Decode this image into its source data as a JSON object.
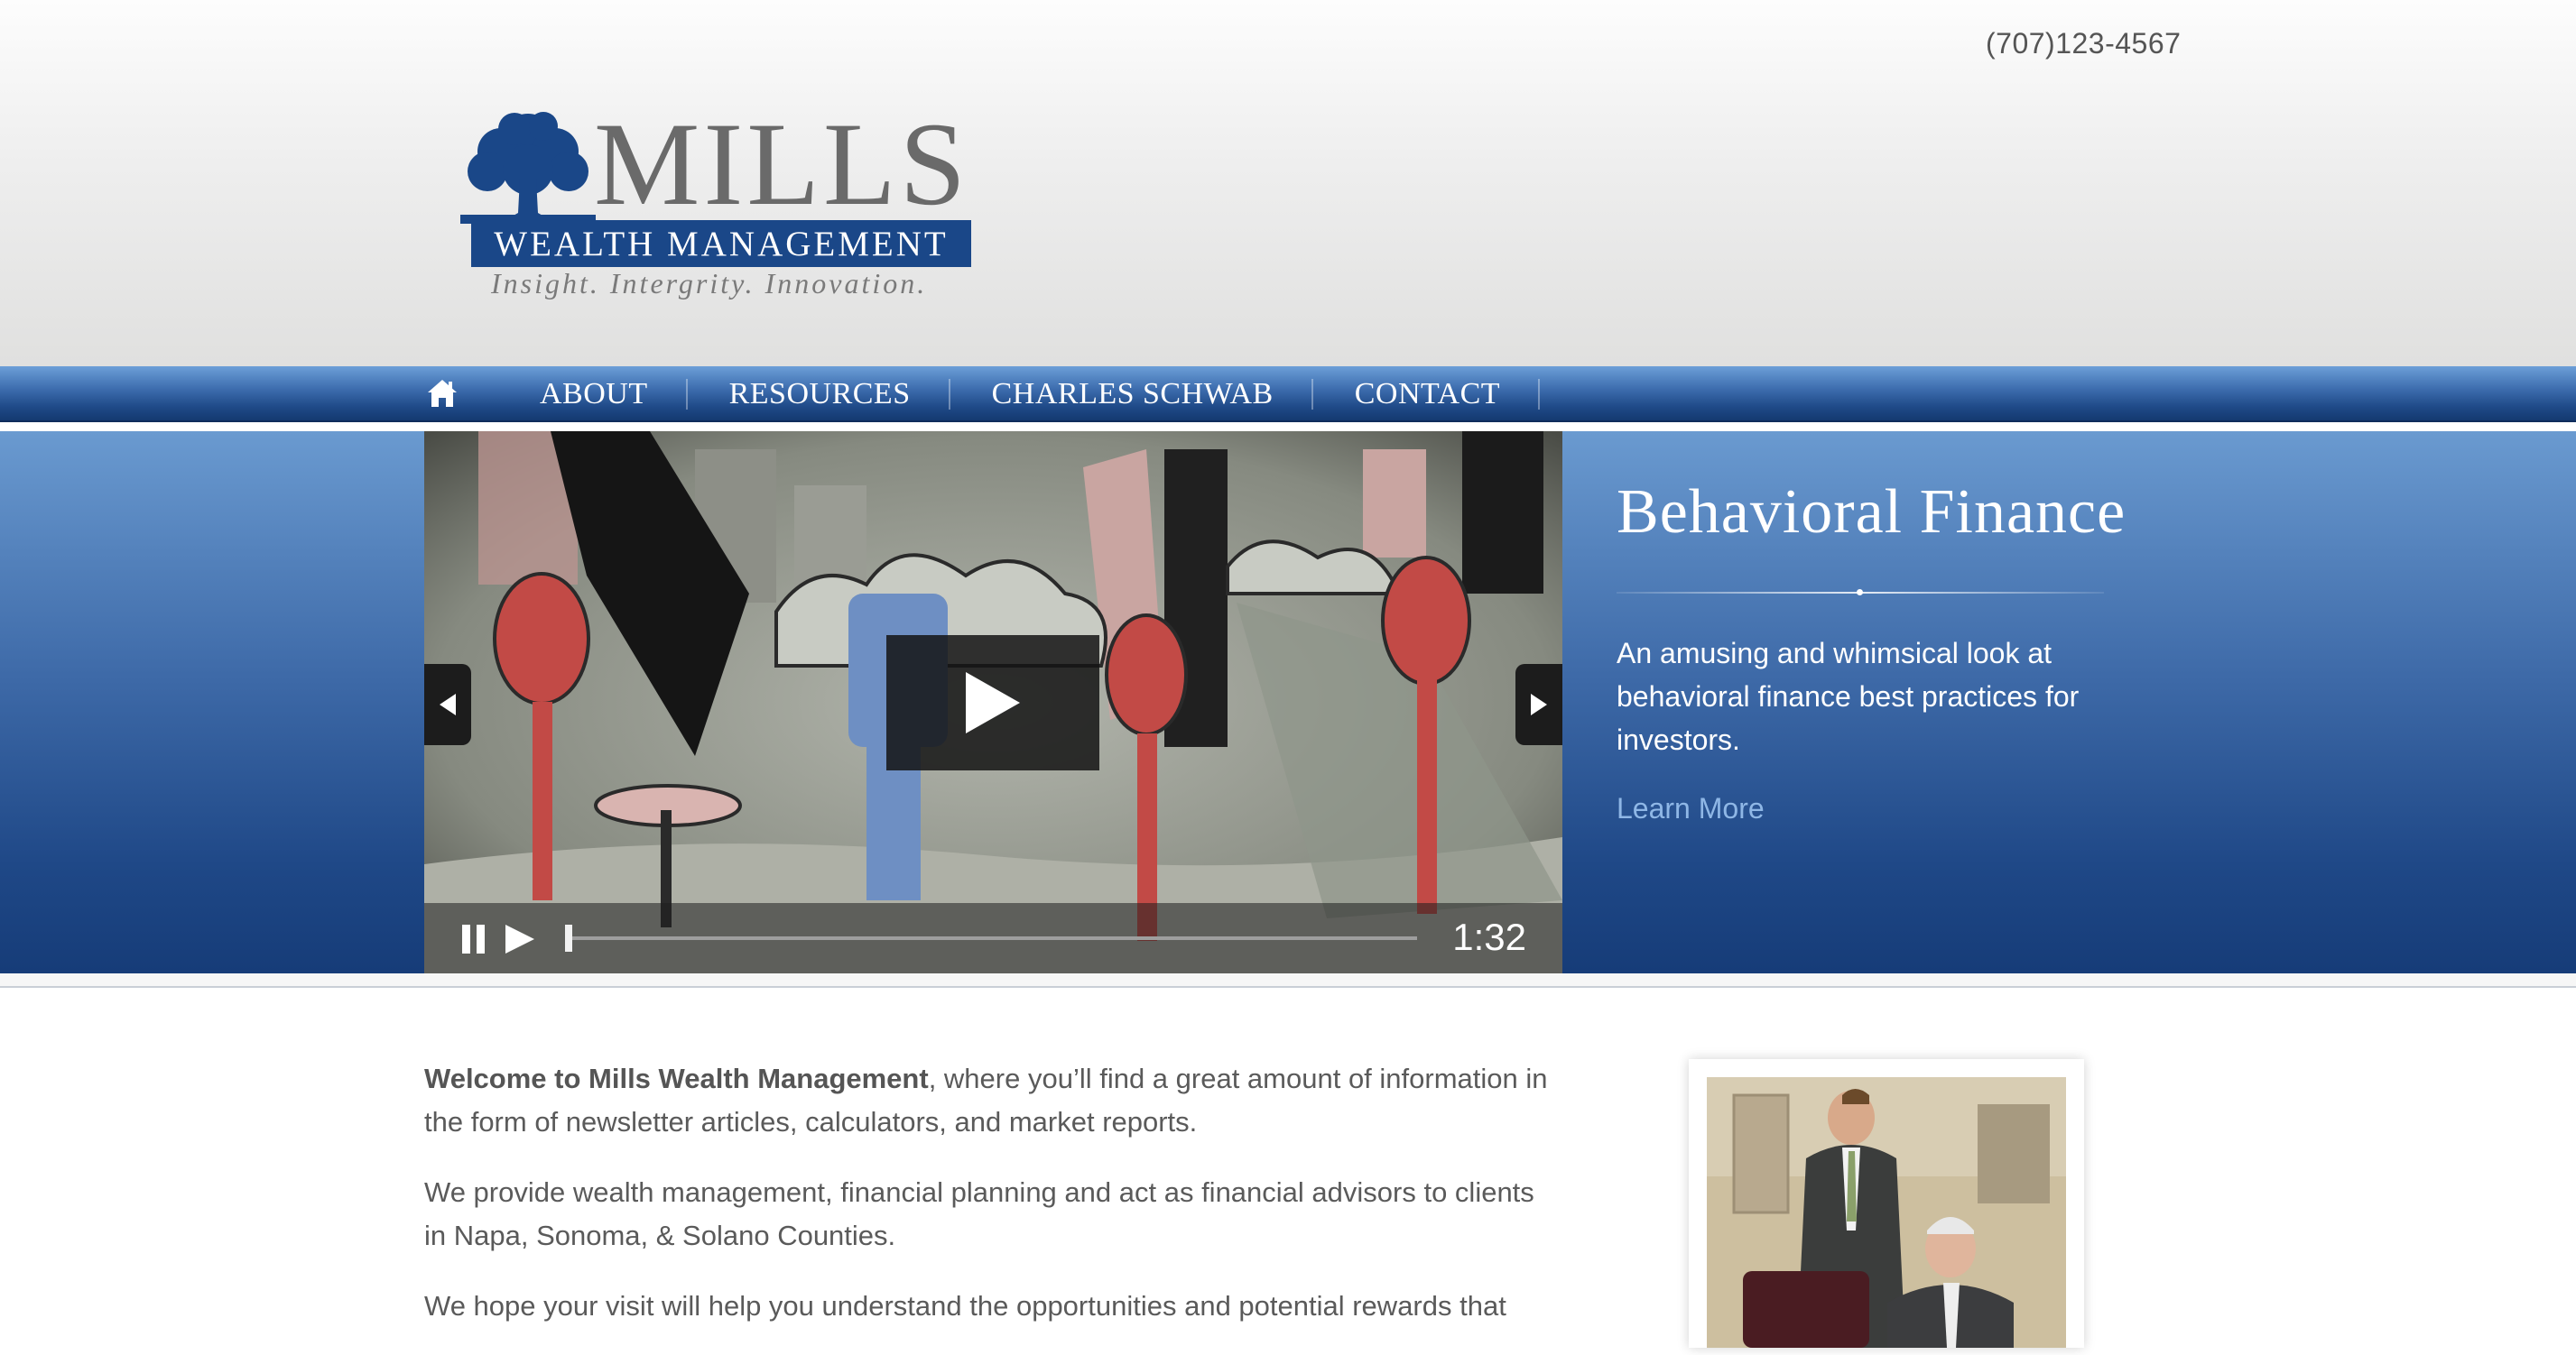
{
  "header": {
    "phone": "(707)123-4567",
    "logo": {
      "word": "MILLS",
      "subtitle": "WEALTH MANAGEMENT",
      "tagline": "Insight. Intergrity. Innovation."
    }
  },
  "nav": {
    "home_icon": "home-icon",
    "items": [
      {
        "label": "ABOUT"
      },
      {
        "label": "RESOURCES"
      },
      {
        "label": "CHARLES SCHWAB"
      },
      {
        "label": "CONTACT"
      }
    ]
  },
  "hero": {
    "title": "Behavioral Finance",
    "description": "An amusing and whimsical look at behavioral finance best practices for investors.",
    "link": "Learn More",
    "video": {
      "time": "1:32",
      "progress": 0.0
    }
  },
  "content": {
    "intro_bold": "Welcome to Mills Wealth Management",
    "intro_rest": ", where you’ll find a great amount of information in the form of newsletter articles, calculators, and market reports.",
    "para2": "We provide wealth management, financial planning and act as financial advisors to clients in Napa, Sonoma, & Solano Counties.",
    "para3": "We hope your visit will help you understand the opportunities and potential rewards that"
  },
  "colors": {
    "brand_blue": "#1a4788",
    "nav_gradient_top": "#6c9fd8",
    "nav_gradient_bottom": "#143970",
    "link": "#8fb7e6",
    "body_text": "#5a5a5a"
  }
}
